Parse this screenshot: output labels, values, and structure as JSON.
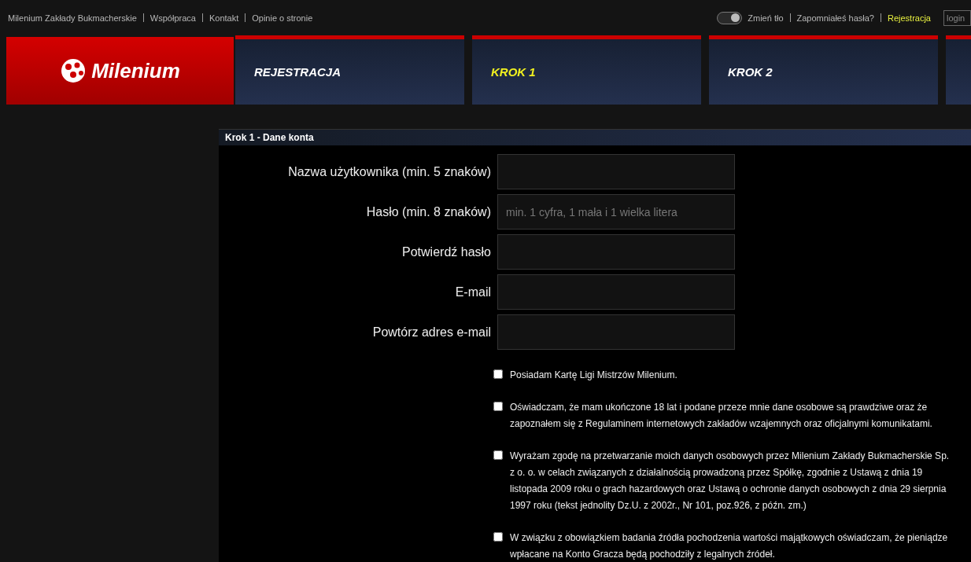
{
  "top_links": [
    "Milenium Zakłady Bukmacherskie",
    "Współpraca",
    "Kontakt",
    "Opinie o stronie"
  ],
  "background_switch": {
    "label": "Zmień tło",
    "on": true
  },
  "account_links": [
    {
      "label": "Zapomniałeś hasła?",
      "highlighted": false
    },
    {
      "label": "Rejestracja",
      "highlighted": true
    }
  ],
  "login_field": {
    "placeholder": "login"
  },
  "logo": {
    "text": "Milenium"
  },
  "steps": [
    {
      "label": "REJESTRACJA",
      "selected": false
    },
    {
      "label": "KROK 1",
      "selected": true
    },
    {
      "label": "KROK 2",
      "selected": false
    }
  ],
  "form": {
    "title": "Krok 1 - Dane konta",
    "fields": [
      {
        "label": "Nazwa użytkownika (min. 5 znaków)"
      },
      {
        "label": "Hasło (min. 8 znaków)",
        "placeholder": "min. 1 cyfra, 1 mała i 1 wielka litera"
      },
      {
        "label": "Potwierdź hasło"
      },
      {
        "label": "E-mail"
      },
      {
        "label": "Powtórz adres e-mail"
      }
    ],
    "consents": [
      {
        "text": "Posiadam Kartę Ligi Mistrzów Milenium.",
        "checked": false
      },
      {
        "text": "Oświadczam, że mam ukończone 18 lat i podane przeze mnie dane osobowe są prawdziwe oraz że zapoznałem się z Regulaminem internetowych zakładów wzajemnych oraz oficjalnymi komunikatami.",
        "checked": false
      },
      {
        "text": "Wyrażam zgodę na przetwarzanie moich danych osobowych przez Milenium Zakłady Bukmacherskie Sp. z o. o. w celach związanych z działalnością prowadzoną przez Spółkę, zgodnie z Ustawą z dnia 19 listopada 2009 roku o grach hazardowych oraz Ustawą o ochronie danych osobowych z dnia 29 sierpnia 1997 roku (tekst jednolity Dz.U. z 2002r., Nr 101, poz.926, z późn. zm.)",
        "checked": false
      },
      {
        "text": "W związku z obowiązkiem badania źródła pochodzenia wartości majątkowych oświadczam, że pieniądze wpłacane na Konto Gracza będą pochodziły z legalnych źródeł.",
        "checked": false
      }
    ]
  }
}
